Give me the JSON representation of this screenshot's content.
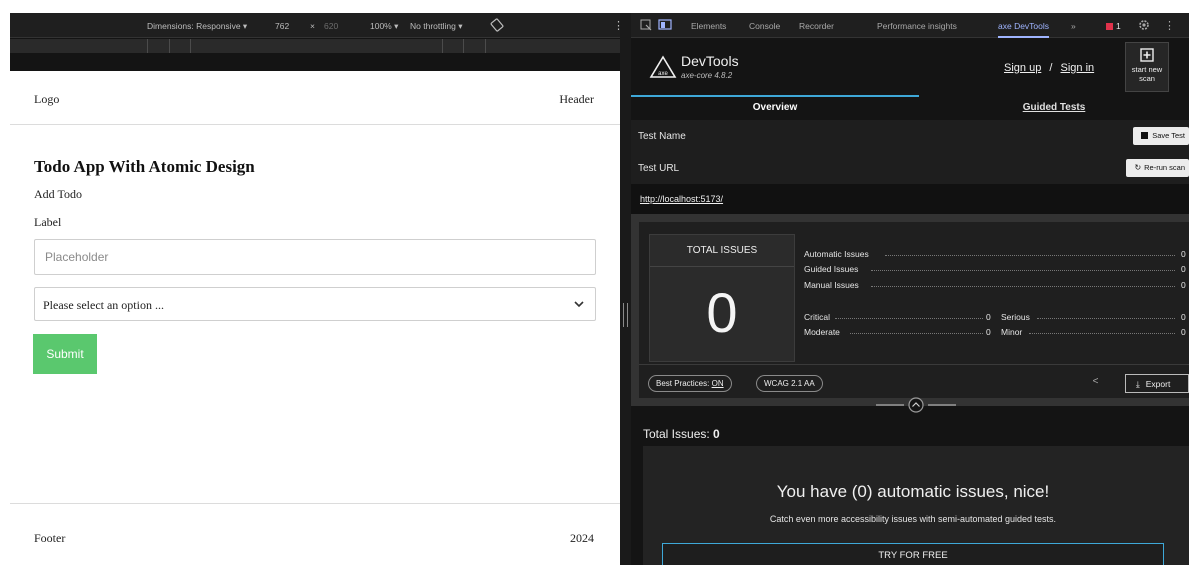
{
  "device_toolbar": {
    "dimensions_label": "Dimensions: Responsive ▾",
    "width": "762",
    "times": "×",
    "height": "620",
    "zoom": "100% ▾",
    "throttling": "No throttling ▾"
  },
  "page": {
    "logo": "Logo",
    "header": "Header",
    "title": "Todo App With Atomic Design",
    "add_todo": "Add Todo",
    "label": "Label",
    "input_placeholder": "Placeholder",
    "select_value": "Please select an option ...",
    "submit_label": "Submit",
    "footer": "Footer",
    "year": "2024"
  },
  "devtools": {
    "tabs": [
      "Elements",
      "Console",
      "Recorder",
      "Performance insights",
      "axe DevTools",
      "»"
    ],
    "active_tab": "axe DevTools",
    "error_count": "1",
    "axe": {
      "title": "DevTools",
      "version": "axe-core 4.8.2",
      "logo_text": "axe",
      "sign_up": "Sign up",
      "separator": "/",
      "sign_in": "Sign in",
      "start_new_scan": "start new scan",
      "tab_overview": "Overview",
      "tab_guided": "Guided Tests",
      "test_name_label": "Test Name",
      "save_test": "Save Test",
      "test_url_label": "Test URL",
      "rerun_scan": "Re-run scan",
      "url": "http://localhost:5173/",
      "total_issues_header": "TOTAL ISSUES",
      "total_issues_value": "0",
      "stats": {
        "automatic": {
          "label": "Automatic Issues",
          "value": "0"
        },
        "guided": {
          "label": "Guided Issues",
          "value": "0"
        },
        "manual": {
          "label": "Manual Issues",
          "value": "0"
        },
        "critical": {
          "label": "Critical",
          "value": "0"
        },
        "serious": {
          "label": "Serious",
          "value": "0"
        },
        "moderate": {
          "label": "Moderate",
          "value": "0"
        },
        "minor": {
          "label": "Minor",
          "value": "0"
        }
      },
      "best_practices_label": "Best Practices:",
      "best_practices_value": "ON",
      "wcag": "WCAG 2.1 AA",
      "export": "Export",
      "total_issues_line_label": "Total Issues:",
      "total_issues_line_value": "0",
      "nice_heading": "You have (0) automatic issues, nice!",
      "nice_sub": "Catch even more accessibility issues with semi-automated guided tests.",
      "try_free": "TRY FOR FREE"
    }
  },
  "colors": {
    "submit_green": "#5ac86e",
    "accent_blue": "#3ea8d8",
    "devtools_bg": "#141414"
  }
}
